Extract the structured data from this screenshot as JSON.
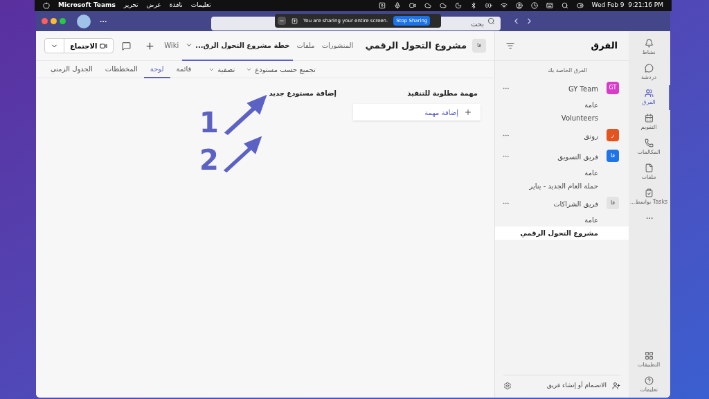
{
  "menubar": {
    "app": "Microsoft Teams",
    "menus": [
      "تعليمات",
      "نافذة",
      "عرض",
      "تحرير"
    ],
    "clock": "Wed Feb 9  9:21:16 PM"
  },
  "titlebar": {
    "search": {
      "placeholder": "بحث"
    }
  },
  "share_banner": {
    "message": "You are sharing your entire screen.",
    "button": "Stop Sharing"
  },
  "rail": {
    "items": [
      {
        "label": "نشاط",
        "selected": false
      },
      {
        "label": "دردشة",
        "selected": false
      },
      {
        "label": "الفرق",
        "selected": true
      },
      {
        "label": "التقويم",
        "selected": false
      },
      {
        "label": "المكالمات",
        "selected": false
      },
      {
        "label": "ملفات",
        "selected": false
      },
      {
        "label": "Tasks بواسط...",
        "selected": false
      }
    ],
    "bottom_items": [
      {
        "label": "التطبيقات"
      },
      {
        "label": "تعليمات"
      }
    ]
  },
  "teams_panel": {
    "title": "الفرق",
    "section": "الفرق الخاصة بك",
    "teams": [
      {
        "name": "GY Team",
        "initials": "GT",
        "color": "#d93bc9",
        "channels": [
          {
            "name": "عامة",
            "selected": false
          },
          {
            "name": "Volunteers",
            "selected": false
          }
        ]
      },
      {
        "name": "رونق",
        "initials": "ر",
        "color": "#e4541f"
      },
      {
        "name": "فريق التسويق",
        "initials": "فا",
        "color": "#1f74e6",
        "channels": [
          {
            "name": "عامة",
            "selected": false
          },
          {
            "name": "حملة العام الجديد - يناير",
            "selected": false
          }
        ]
      },
      {
        "name": "فريق الشراكات",
        "initials": "فا",
        "color": "#e3e3e3",
        "channels": [
          {
            "name": "عامة",
            "selected": false
          },
          {
            "name": "مشروع التحول الرقمي",
            "selected": true
          }
        ]
      }
    ],
    "join": "الانضمام أو إنشاء فريق"
  },
  "channel_header": {
    "initials": "فا",
    "title": "مشروع التحول الرقمي",
    "tabs": [
      {
        "label": "المنشورات",
        "selected": false,
        "dropdown": false
      },
      {
        "label": "ملفات",
        "selected": false,
        "dropdown": false
      },
      {
        "label": "خطة مشروع التحول الرق...",
        "selected": true,
        "dropdown": true
      },
      {
        "label": "Wiki",
        "selected": false,
        "dropdown": false
      }
    ],
    "meet_button": "الاجتماع"
  },
  "planner": {
    "toolbar": [
      {
        "label": "تجميع حسب مستودع"
      },
      {
        "label": "تصفية"
      }
    ],
    "views": [
      {
        "label": "قائمة",
        "selected": false
      },
      {
        "label": "لوحة",
        "selected": true
      },
      {
        "label": "المخططات",
        "selected": false
      },
      {
        "label": "الجدول الزمني",
        "selected": false
      }
    ],
    "buckets": [
      {
        "title": "مهمة مطلوبة للتنفيذ",
        "add_task": "إضافة مهمة"
      }
    ],
    "add_bucket": "إضافة مستودع جديد"
  },
  "annotations": [
    {
      "label": "1"
    },
    {
      "label": "2"
    }
  ]
}
